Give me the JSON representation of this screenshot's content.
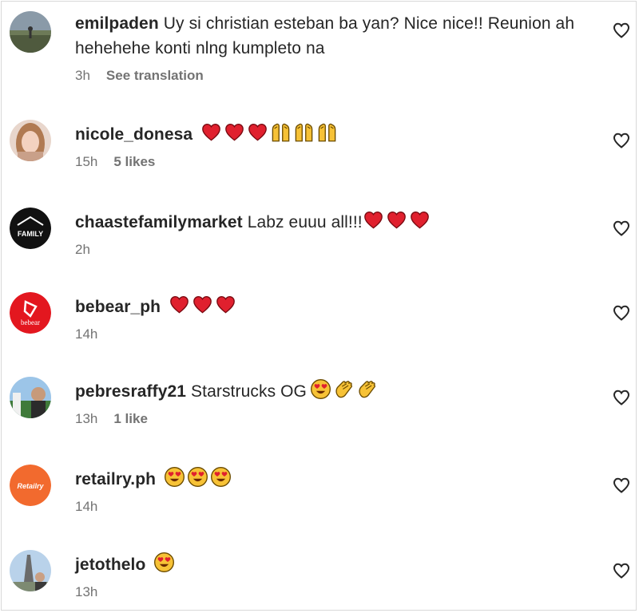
{
  "comments": [
    {
      "username": "emilpaden",
      "text": "Uy si christian esteban ba yan? Nice nice!! Reunion ah hehehehe konti nlng kumpleto na",
      "time": "3h",
      "action": "See translation",
      "emojis": []
    },
    {
      "username": "nicole_donesa",
      "text": "",
      "time": "15h",
      "action": "5 likes",
      "emojis": [
        "red-heart-icon",
        "red-heart-icon",
        "red-heart-icon",
        "raising-hands-icon",
        "raising-hands-icon",
        "raising-hands-icon"
      ]
    },
    {
      "username": "chaastefamilymarket",
      "text": "Labz euuu all!!!",
      "time": "2h",
      "action": "",
      "emojis": [
        "red-heart-icon",
        "red-heart-icon",
        "red-heart-icon"
      ]
    },
    {
      "username": "bebear_ph",
      "text": "",
      "time": "14h",
      "action": "",
      "emojis": [
        "red-heart-icon",
        "red-heart-icon",
        "red-heart-icon"
      ]
    },
    {
      "username": "pebresraffy21",
      "text": "Starstrucks OG",
      "time": "13h",
      "action": "1 like",
      "emojis": [
        "heart-eyes-icon",
        "clapping-hands-icon",
        "clapping-hands-icon"
      ]
    },
    {
      "username": "retailry.ph",
      "text": "",
      "time": "14h",
      "action": "",
      "emojis": [
        "heart-eyes-icon",
        "heart-eyes-icon",
        "heart-eyes-icon"
      ]
    },
    {
      "username": "jetothelo",
      "text": "",
      "time": "13h",
      "action": "",
      "emojis": [
        "heart-eyes-icon"
      ]
    }
  ],
  "avatars": {
    "chaastefamilymarket": "FAMILY",
    "bebear_ph": "bebear",
    "retailry.ph": "Retailry"
  },
  "colors": {
    "text": "#262626",
    "secondary": "#737373",
    "heart_red": "#e0202e",
    "emoji_yellow": "#f7c236"
  }
}
